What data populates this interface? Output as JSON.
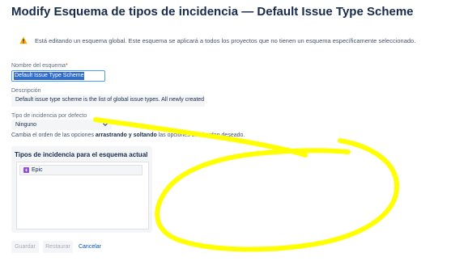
{
  "page": {
    "title": "Modify Esquema de tipos de incidencia — Default Issue Type Scheme"
  },
  "warning": {
    "icon": "warning-icon",
    "text": "Está editando un esquema global. Este esquema se aplicará a todos los proyectos que no tienen un esquema específicamente seleccionado."
  },
  "form": {
    "name_label": "Nombre del esquema",
    "name_required_marker": "*",
    "name_value": "Default Issue Type Scheme",
    "description_label": "Descripción",
    "description_value": "Default issue type scheme is the list of global issue types. All newly created iss",
    "default_type_label": "Tipo de incidencia por defecto",
    "default_type_value": "Ninguno",
    "reorder_hint_prefix": "Cambia el orden de las opciones ",
    "reorder_hint_bold": "arrastrando y soltando",
    "reorder_hint_suffix": " las opciones en el orden deseado."
  },
  "scheme_panel": {
    "title": "Tipos de incidencia para el esquema actual",
    "items": [
      {
        "label": "Epic",
        "icon": "epic-icon"
      }
    ]
  },
  "buttons": {
    "save": "Guardar",
    "reset": "Restaurar",
    "cancel": "Cancelar"
  },
  "colors": {
    "primary_text": "#172b4d",
    "link": "#0052cc",
    "warning": "#ffab00",
    "epic": "#904ee2",
    "annotation": "#ffff00"
  }
}
